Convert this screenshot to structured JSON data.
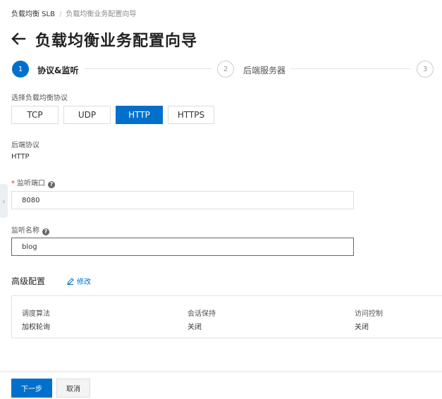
{
  "breadcrumb": {
    "root": "负载均衡 SLB",
    "separator": "/",
    "current": "负载均衡业务配置向导"
  },
  "header": {
    "back_icon": "arrow-left-icon",
    "title": "负载均衡业务配置向导"
  },
  "steps": [
    {
      "number": "1",
      "label": "协议&监听",
      "state": "active"
    },
    {
      "number": "2",
      "label": "后端服务器",
      "state": "pending"
    },
    {
      "number": "3",
      "label": "",
      "state": "pending"
    }
  ],
  "protocol": {
    "label": "选择负载均衡协议",
    "options": [
      "TCP",
      "UDP",
      "HTTP",
      "HTTPS"
    ],
    "selected": "HTTP"
  },
  "backend_protocol": {
    "label": "后端协议",
    "value": "HTTP"
  },
  "listen_port": {
    "label": "监听端口",
    "required": true,
    "help_icon": "question-circle-icon",
    "value": "8080"
  },
  "listener_name": {
    "label": "监听名称",
    "help_icon": "question-circle-icon",
    "value": "blog"
  },
  "advanced": {
    "title": "高级配置",
    "edit_label": "修改",
    "edit_icon": "pencil-icon",
    "items": [
      {
        "key": "调度算法",
        "value": "加权轮询"
      },
      {
        "key": "会话保持",
        "value": "关闭"
      },
      {
        "key": "访问控制",
        "value": "关闭"
      }
    ]
  },
  "footer": {
    "next_label": "下一步",
    "cancel_label": "取消"
  },
  "colors": {
    "primary": "#0070cc",
    "required": "#e0281d",
    "border": "#dddddd"
  }
}
